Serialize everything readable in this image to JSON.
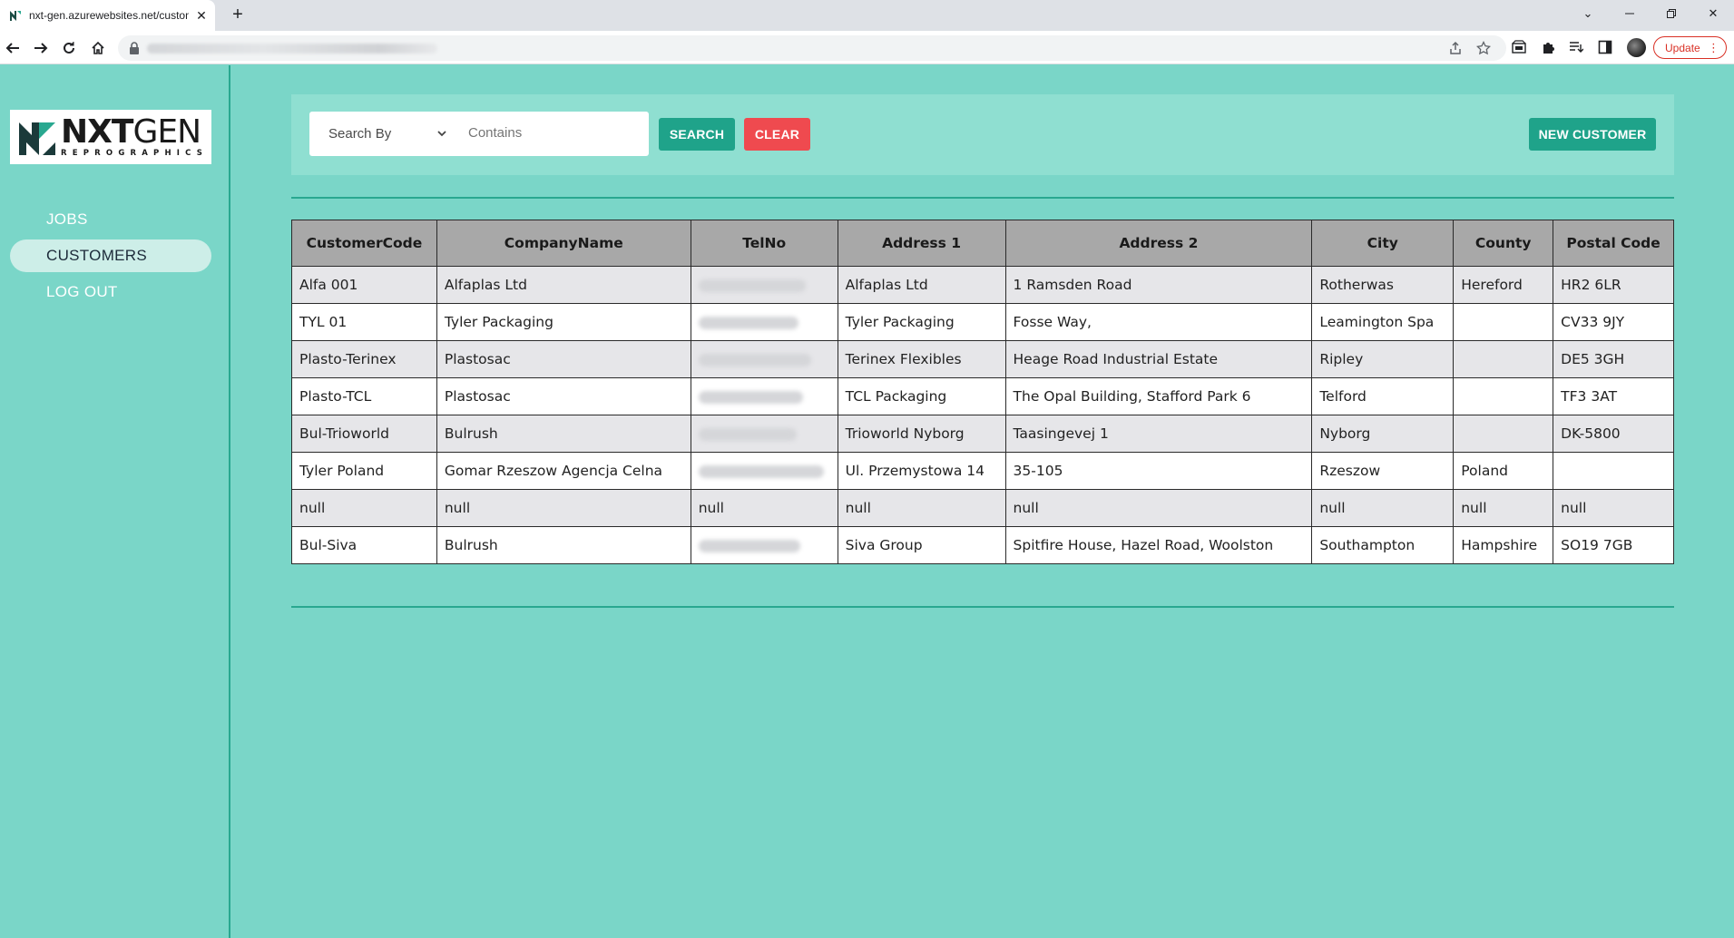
{
  "browser": {
    "tab_title": "nxt-gen.azurewebsites.net/customers",
    "update_label": "Update"
  },
  "app": {
    "logo": {
      "main_bold": "NXT",
      "main_light": "GEN",
      "sub": "REPROGRAPHICS"
    },
    "nav": [
      {
        "label": "JOBS",
        "active": false
      },
      {
        "label": "CUSTOMERS",
        "active": true
      },
      {
        "label": "LOG OUT",
        "active": false
      }
    ],
    "search": {
      "search_by_label": "Search By",
      "contains_placeholder": "Contains",
      "search_button": "SEARCH",
      "clear_button": "CLEAR",
      "new_customer_button": "NEW CUSTOMER"
    },
    "table": {
      "columns": [
        "CustomerCode",
        "CompanyName",
        "TelNo",
        "Address 1",
        "Address 2",
        "City",
        "County",
        "Postal Code"
      ],
      "rows": [
        [
          "Alfa 001",
          "Alfaplas Ltd",
          "",
          "Alfaplas Ltd",
          "1 Ramsden Road",
          "Rotherwas",
          "Hereford",
          "HR2 6LR"
        ],
        [
          "TYL 01",
          "Tyler Packaging",
          "",
          "Tyler Packaging",
          "Fosse Way,",
          "Leamington Spa",
          "",
          "CV33 9JY"
        ],
        [
          "Plasto-Terinex",
          "Plastosac",
          "",
          "Terinex Flexibles",
          "Heage Road Industrial Estate",
          "Ripley",
          "",
          "DE5 3GH"
        ],
        [
          "Plasto-TCL",
          "Plastosac",
          "",
          "TCL Packaging",
          "The Opal Building, Stafford Park 6",
          "Telford",
          "",
          "TF3 3AT"
        ],
        [
          "Bul-Trioworld",
          "Bulrush",
          "",
          "Trioworld Nyborg",
          "Taasingevej 1",
          "Nyborg",
          "",
          "DK-5800"
        ],
        [
          "Tyler Poland",
          "Gomar Rzeszow Agencja Celna",
          "",
          "Ul. Przemystowa 14",
          "35-105",
          "Rzeszow",
          "Poland",
          ""
        ],
        [
          "null",
          "null",
          "null",
          "null",
          "null",
          "null",
          "null",
          "null"
        ],
        [
          "Bul-Siva",
          "Bulrush",
          "",
          "Siva Group",
          "Spitfire House, Hazel Road, Woolston",
          "Southampton",
          "Hampshire",
          "SO19 7GB"
        ]
      ],
      "telno_blurred": [
        true,
        true,
        true,
        true,
        true,
        true,
        false,
        true
      ]
    }
  },
  "colors": {
    "page_bg": "#7ad6c8",
    "accent": "#1fa38a",
    "danger": "#ef4a4f"
  }
}
